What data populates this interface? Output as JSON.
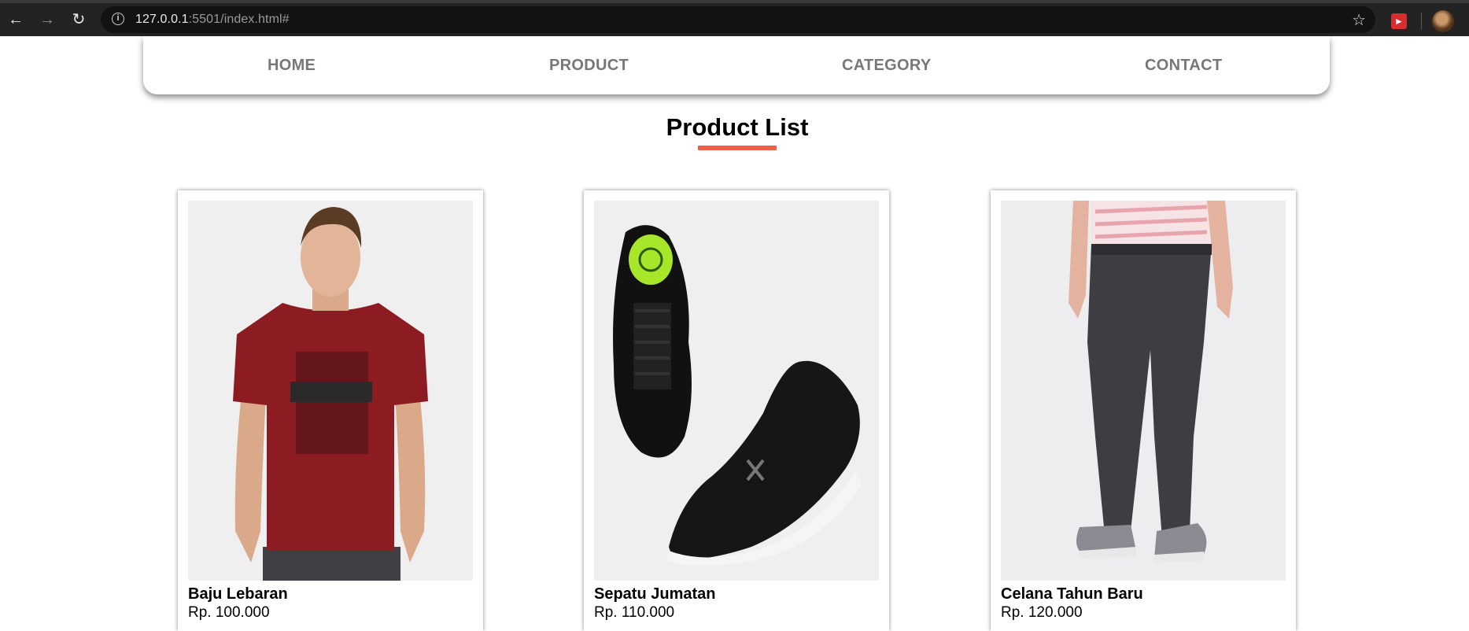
{
  "browser": {
    "url_host": "127.0.0.1",
    "url_rest": ":5501/index.html#"
  },
  "nav": {
    "items": [
      {
        "label": "HOME"
      },
      {
        "label": "PRODUCT"
      },
      {
        "label": "CATEGORY"
      },
      {
        "label": "CONTACT"
      }
    ]
  },
  "page": {
    "title": "Product List",
    "accent_color": "#ef6148"
  },
  "products": [
    {
      "name": "Baju Lebaran",
      "price": "Rp. 100.000",
      "image": "red-tshirt-model"
    },
    {
      "name": "Sepatu Jumatan",
      "price": "Rp. 110.000",
      "image": "black-sneakers"
    },
    {
      "name": "Celana Tahun Baru",
      "price": "Rp. 120.000",
      "image": "grey-jogger-pants"
    }
  ]
}
